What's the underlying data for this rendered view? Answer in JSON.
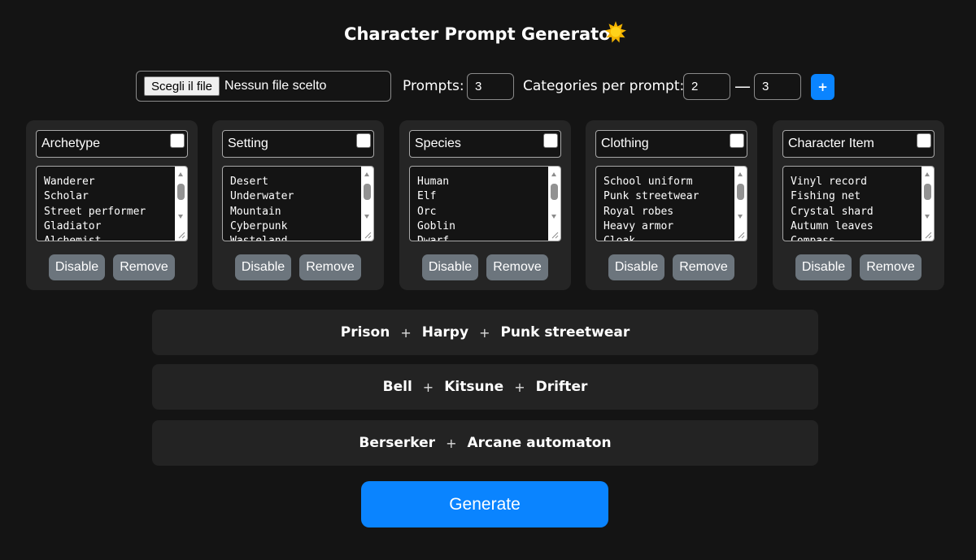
{
  "app": {
    "title": "Character Prompt Generator",
    "title_icon": "sun-icon",
    "accent_color": "#0a84ff"
  },
  "toolbar": {
    "file_button_label": "Scegli il file",
    "file_status": "Nessun file scelto",
    "prompts_label": "Prompts:",
    "prompts_value": "3",
    "categories_label": "Categories per prompt:",
    "categories_min": "2",
    "range_separator": "—",
    "categories_max": "3",
    "add_button_label": "+"
  },
  "categories": [
    {
      "name": "Archetype",
      "checked": false,
      "items": [
        "Wanderer",
        "Scholar",
        "Street performer",
        "Gladiator",
        "Alchemist"
      ],
      "disable_label": "Disable",
      "remove_label": "Remove"
    },
    {
      "name": "Setting",
      "checked": false,
      "items": [
        "Desert",
        "Underwater",
        "Mountain",
        "Cyberpunk",
        "Wasteland"
      ],
      "disable_label": "Disable",
      "remove_label": "Remove"
    },
    {
      "name": "Species",
      "checked": false,
      "items": [
        "Human",
        "Elf",
        "Orc",
        "Goblin",
        "Dwarf"
      ],
      "disable_label": "Disable",
      "remove_label": "Remove"
    },
    {
      "name": "Clothing",
      "checked": false,
      "items": [
        "School uniform",
        "Punk streetwear",
        "Royal robes",
        "Heavy armor",
        "Cloak"
      ],
      "disable_label": "Disable",
      "remove_label": "Remove"
    },
    {
      "name": "Character Item",
      "checked": false,
      "items": [
        "Vinyl record",
        "Fishing net",
        "Crystal shard",
        "Autumn leaves",
        "Compass"
      ],
      "disable_label": "Disable",
      "remove_label": "Remove"
    }
  ],
  "results": [
    {
      "parts": [
        "Prison",
        "Harpy",
        "Punk streetwear"
      ],
      "separator": "+"
    },
    {
      "parts": [
        "Bell",
        "Kitsune",
        "Drifter"
      ],
      "separator": "+"
    },
    {
      "parts": [
        "Berserker",
        "Arcane automaton"
      ],
      "separator": "+"
    }
  ],
  "generate_label": "Generate"
}
